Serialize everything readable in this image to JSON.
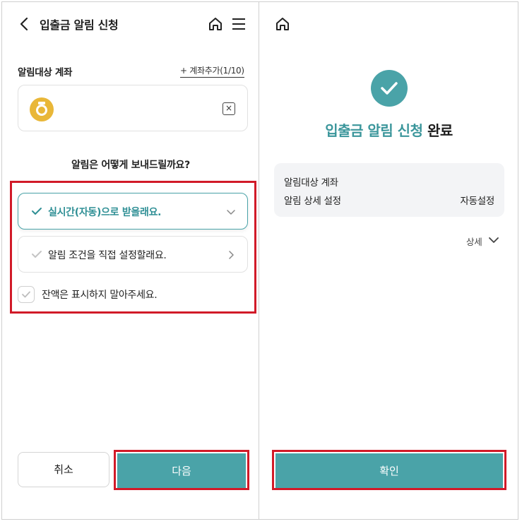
{
  "left": {
    "header": {
      "title": "입출금 알림 신청"
    },
    "account_section": {
      "label": "알림대상 계좌",
      "add_link": "+ 계좌추가(1/10)",
      "clear_symbol": "×"
    },
    "question": "알림은 어떻게 보내드릴까요?",
    "options": [
      {
        "label": "실시간(자동)으로 받을래요.",
        "selected": true
      },
      {
        "label": "알림 조건을 직접 설정할래요.",
        "selected": false
      }
    ],
    "hide_balance": {
      "label": "잔액은 표시하지 말아주세요.",
      "checked": false
    },
    "buttons": {
      "cancel": "취소",
      "next": "다음"
    }
  },
  "right": {
    "title_highlight": "입출금 알림 신청",
    "title_rest": " 완료",
    "summary": [
      {
        "key": "알림대상 계좌",
        "value": ""
      },
      {
        "key": "알림 상세 설정",
        "value": "자동설정"
      }
    ],
    "detail_link": "상세",
    "confirm": "확인"
  },
  "colors": {
    "accent": "#4aa3a8",
    "highlight_outline": "#d11a28",
    "bank_logo": "#e9b738"
  },
  "icons": [
    "back-icon",
    "home-icon",
    "menu-icon",
    "check-icon",
    "chevron-down-icon",
    "chevron-right-icon",
    "close-icon"
  ]
}
